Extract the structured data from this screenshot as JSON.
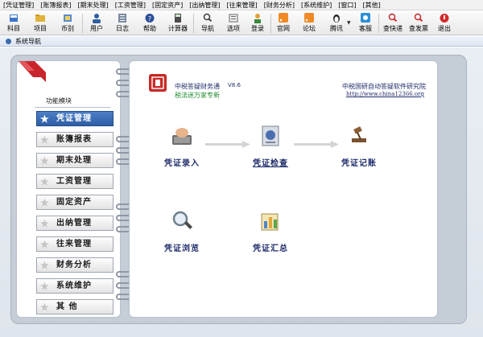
{
  "menu": [
    "[凭证管理]",
    "[账簿报表]",
    "[期末处理]",
    "[工资管理]",
    "[固定资产]",
    "[出纳管理]",
    "[往来管理]",
    "[财务分析]",
    "[系统维护]",
    "[窗口]",
    "[其他]"
  ],
  "toolbar": {
    "subject": "科目",
    "project": "项目",
    "currency": "币别",
    "user": "用户",
    "log": "日志",
    "help": "帮助",
    "calculator": "计算器",
    "navigate": "导航",
    "options": "选项",
    "login": "登录",
    "website": "官网",
    "forum": "论坛",
    "tencent": "腾讯",
    "service": "客服",
    "query_express": "查快递",
    "query_invoice": "查发票",
    "exit": "退出"
  },
  "window": {
    "title": "系统导航"
  },
  "sidebar": {
    "title": "功能模块",
    "items": [
      {
        "label": "凭证管理"
      },
      {
        "label": "账簿报表"
      },
      {
        "label": "期末处理"
      },
      {
        "label": "工资管理"
      },
      {
        "label": "固定资产"
      },
      {
        "label": "出纳管理"
      },
      {
        "label": "往来管理"
      },
      {
        "label": "财务分析"
      },
      {
        "label": "系统维护"
      },
      {
        "label": "其    他"
      }
    ],
    "active_index": 0
  },
  "header": {
    "app_name": "中税答疑财务通",
    "version": "V8.6",
    "slogan": "税法迷万家专新",
    "org_name": "中税国研自动答疑软件研究院",
    "org_url": "http://www.china12366.org"
  },
  "functions": {
    "voucher_entry": "凭证录入",
    "voucher_check": "凭证检查",
    "voucher_posting": "凭证记账",
    "voucher_browse": "凭证浏览",
    "voucher_summary": "凭证汇总"
  },
  "colors": {
    "accent": "#2e5ea6",
    "label_blue": "#1f2b6a",
    "slogan_green": "#1a8a2a",
    "logo_red": "#c62a26",
    "ribbon_red": "#c9252c"
  }
}
